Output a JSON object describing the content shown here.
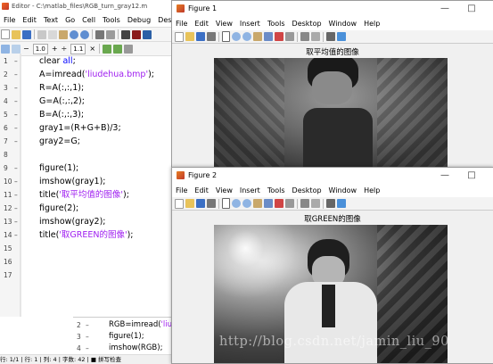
{
  "editor": {
    "title": "Editor - C:\\matlab_files\\RGB_turn_gray12.m",
    "menu": [
      "File",
      "Edit",
      "Text",
      "Go",
      "Cell",
      "Tools",
      "Debug",
      "Desktop"
    ],
    "toolbar": {
      "zoom_a": "1.0",
      "zoom_b": "1.1",
      "minus": "−",
      "plus": "+",
      "divide": "÷",
      "times": "×"
    },
    "lines": [
      {
        "n": "1",
        "dash": "–",
        "parts": [
          {
            "t": "clear "
          },
          {
            "t": "all",
            "c": "kw"
          },
          {
            "t": ";"
          }
        ]
      },
      {
        "n": "2",
        "dash": "–",
        "parts": [
          {
            "t": "A=imread("
          },
          {
            "t": "'liudehua.bmp'",
            "c": "str"
          },
          {
            "t": ");"
          }
        ]
      },
      {
        "n": "3",
        "dash": "–",
        "parts": [
          {
            "t": "R=A(:,:,1);"
          }
        ]
      },
      {
        "n": "4",
        "dash": "–",
        "parts": [
          {
            "t": "G=A(:,:,2);"
          }
        ]
      },
      {
        "n": "5",
        "dash": "–",
        "parts": [
          {
            "t": "B=A(:,:,3);"
          }
        ]
      },
      {
        "n": "6",
        "dash": "–",
        "parts": [
          {
            "t": "gray1=(R+G+B)/3;"
          }
        ]
      },
      {
        "n": "7",
        "dash": "–",
        "parts": [
          {
            "t": "gray2=G;"
          }
        ]
      },
      {
        "n": "8",
        "dash": "",
        "parts": []
      },
      {
        "n": "9",
        "dash": "–",
        "parts": [
          {
            "t": "figure(1);"
          }
        ]
      },
      {
        "n": "10",
        "dash": "–",
        "parts": [
          {
            "t": "imshow(gray1);"
          }
        ]
      },
      {
        "n": "11",
        "dash": "–",
        "parts": [
          {
            "t": "title("
          },
          {
            "t": "'取平均值的图像'",
            "c": "str"
          },
          {
            "t": ");"
          }
        ]
      },
      {
        "n": "12",
        "dash": "–",
        "parts": [
          {
            "t": "figure(2);"
          }
        ]
      },
      {
        "n": "13",
        "dash": "–",
        "parts": [
          {
            "t": "imshow(gray2);"
          }
        ]
      },
      {
        "n": "14",
        "dash": "–",
        "parts": [
          {
            "t": "title("
          },
          {
            "t": "'取GREEN的图像'",
            "c": "str"
          },
          {
            "t": ");"
          }
        ]
      },
      {
        "n": "15",
        "dash": "",
        "parts": []
      },
      {
        "n": "16",
        "dash": "",
        "parts": []
      },
      {
        "n": "17",
        "dash": "",
        "parts": []
      }
    ],
    "second_lines": [
      {
        "n": "2",
        "dash": "–",
        "parts": [
          {
            "t": "RGB=imread("
          },
          {
            "t": "'liu",
            "c": "str"
          }
        ]
      },
      {
        "n": "3",
        "dash": "–",
        "parts": [
          {
            "t": "figure(1);"
          }
        ]
      },
      {
        "n": "4",
        "dash": "–",
        "parts": [
          {
            "t": "imshow(RGB);"
          }
        ]
      }
    ],
    "status": "行: 1/1 | 行: 1 | 列: 4 | 字数: 42 | ■ 拼写检查"
  },
  "figure1": {
    "title": "Figure 1",
    "menu": [
      "File",
      "Edit",
      "View",
      "Insert",
      "Tools",
      "Desktop",
      "Window",
      "Help"
    ],
    "axes_title": "取平均值的图像",
    "minimize": "—",
    "maximize": "□"
  },
  "figure2": {
    "title": "Figure 2",
    "menu": [
      "File",
      "Edit",
      "View",
      "Insert",
      "Tools",
      "Desktop",
      "Window",
      "Help"
    ],
    "axes_title": "取GREEN的图像",
    "minimize": "—",
    "maximize": "□"
  },
  "watermark": "http://blog.csdn.net/jamin_liu_90",
  "colors": {
    "keyword": "#0000ff",
    "string": "#a020f0",
    "matlab_logo": "#e67e22"
  }
}
